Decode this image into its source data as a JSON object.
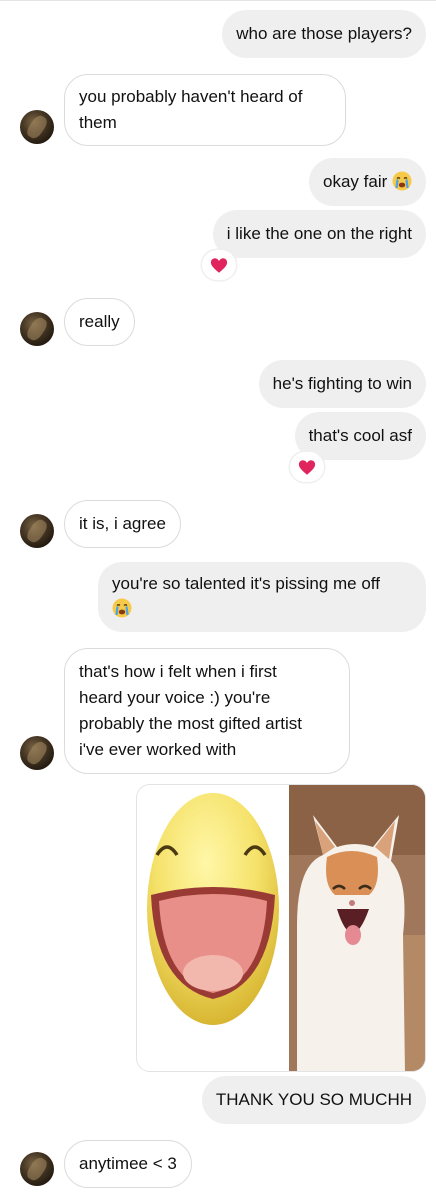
{
  "messages": [
    {
      "id": "m1",
      "text": "who are those players?"
    },
    {
      "id": "m2",
      "line1": "you probably haven't heard of",
      "line2": "them"
    },
    {
      "id": "m3",
      "text": "okay fair"
    },
    {
      "id": "m4",
      "text": "i like the one on the right"
    },
    {
      "id": "m5",
      "text": "really"
    },
    {
      "id": "m6",
      "text": "he's fighting to win"
    },
    {
      "id": "m7",
      "text": "that's cool asf"
    },
    {
      "id": "m8",
      "text": "it is, i agree"
    },
    {
      "id": "m9",
      "text": "you're so talented it's pissing me off"
    },
    {
      "id": "m10",
      "line1": "that's how i felt when i first",
      "line2": "heard your voice :) you're",
      "line3": "probably the most gifted artist",
      "line4": "i've ever worked with"
    },
    {
      "id": "m11",
      "text": "THANK YOU SO MUCHH"
    },
    {
      "id": "m12",
      "text": "anytimee < 3"
    }
  ],
  "reactions": {
    "heart": "heart-reaction"
  },
  "colors": {
    "outgoing_bubble": "#efefef",
    "incoming_border": "#dbdbdb",
    "heart": "#e0245e"
  },
  "icons": [
    "crying-emoji-icon",
    "heart-icon",
    "avatar"
  ],
  "image_message": {
    "left": "laughing-emoji-face",
    "right": "laughing-cat-photo"
  }
}
